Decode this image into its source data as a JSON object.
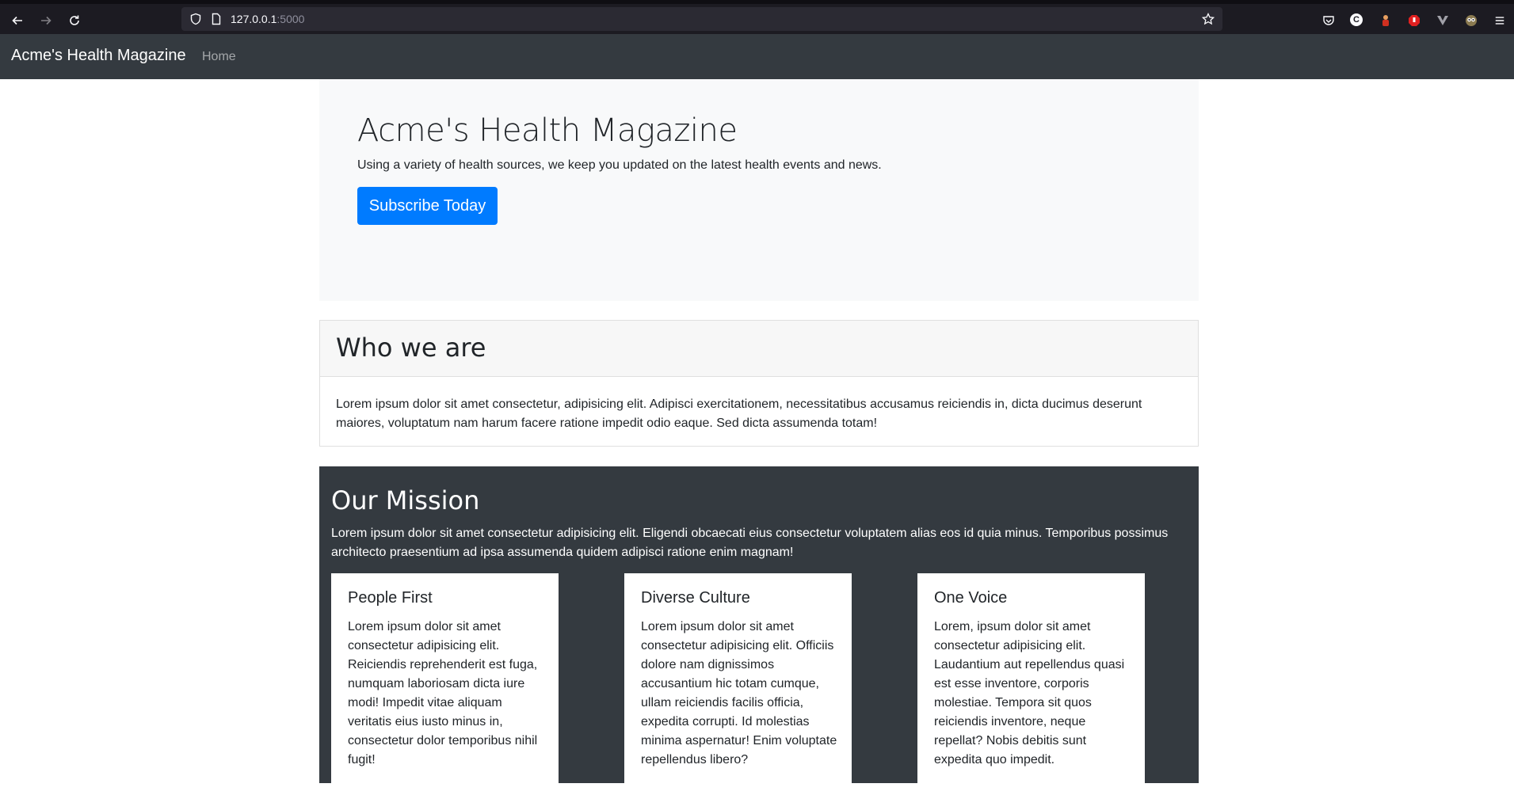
{
  "browser": {
    "url_host": "127.0.0.1",
    "url_port": ":5000",
    "icons": [
      "back-icon",
      "forward-icon",
      "reload-icon",
      "shield-icon",
      "page-icon",
      "star-icon",
      "pocket-icon",
      "extension-c-icon",
      "extension-figure-icon",
      "extension-stop-icon",
      "extension-v-icon",
      "extension-owl-icon",
      "menu-icon"
    ]
  },
  "navbar": {
    "brand": "Acme's Health Magazine",
    "home": "Home"
  },
  "hero": {
    "title": "Acme's Health Magazine",
    "subtitle": "Using a variety of health sources, we keep you updated on the latest health events and news.",
    "button": "Subscribe Today",
    "button_color": "#007bff"
  },
  "who": {
    "title": "Who we are",
    "body": "Lorem ipsum dolor sit amet consectetur, adipisicing elit. Adipisci exercitationem, necessitatibus accusamus reiciendis in, dicta ducimus deserunt maiores, voluptatum nam harum facere ratione impedit odio eaque. Sed dicta assumenda totam!"
  },
  "mission": {
    "title": "Our Mission",
    "body": "Lorem ipsum dolor sit amet consectetur adipisicing elit. Eligendi obcaecati eius consectetur voluptatem alias eos id quia minus. Temporibus possimus architecto praesentium ad ipsa assumenda quidem adipisci ratione enim magnam!",
    "cards": [
      {
        "title": "People First",
        "body": "Lorem ipsum dolor sit amet consectetur adipisicing elit. Reiciendis reprehenderit est fuga, numquam laboriosam dicta iure modi! Impedit vitae aliquam veritatis eius iusto minus in, consectetur dolor temporibus nihil fugit!"
      },
      {
        "title": "Diverse Culture",
        "body": "Lorem ipsum dolor sit amet consectetur adipisicing elit. Officiis dolore nam dignissimos accusantium hic totam cumque, ullam reiciendis facilis officia, expedita corrupti. Id molestias minima aspernatur! Enim voluptate repellendus libero?"
      },
      {
        "title": "One Voice",
        "body": "Lorem, ipsum dolor sit amet consectetur adipisicing elit. Laudantium aut repellendus quasi est esse inventore, corporis molestiae. Tempora sit quos reiciendis inventore, neque repellat? Nobis debitis sunt expedita quo impedit."
      }
    ]
  }
}
